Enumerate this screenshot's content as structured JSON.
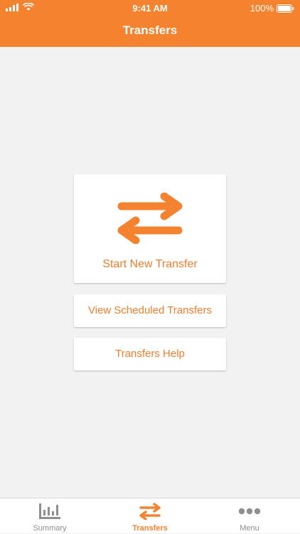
{
  "status_bar": {
    "time": "9:41 AM",
    "battery": "100%"
  },
  "header": {
    "title": "Transfers"
  },
  "actions": {
    "start_new": "Start New Transfer",
    "view_scheduled": "View Scheduled Transfers",
    "help": "Transfers Help"
  },
  "tabs": [
    {
      "label": "Summary",
      "icon": "bar-chart-icon"
    },
    {
      "label": "Transfers",
      "icon": "transfer-arrows-icon",
      "active": true
    },
    {
      "label": "Menu",
      "icon": "more-dots-icon"
    }
  ],
  "colors": {
    "accent": "#f5822f",
    "background": "#f2f2f2",
    "inactive": "#8e8e8e"
  }
}
